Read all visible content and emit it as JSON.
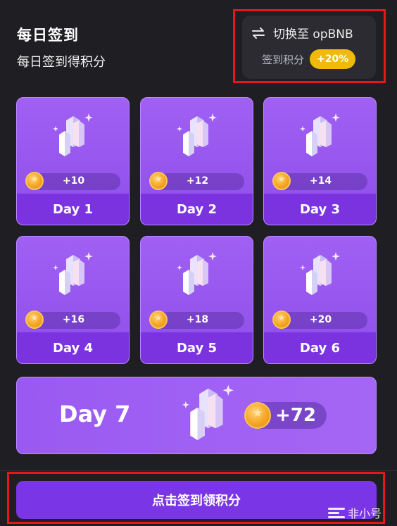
{
  "header": {
    "title": "每日签到",
    "subtitle": "每日签到得积分"
  },
  "switch": {
    "icon": "swap-arrows-icon",
    "label": "切换至 opBNB",
    "bonus_label": "签到积分",
    "bonus_value": "+20%",
    "bonus_color": "#f0b90b"
  },
  "days": [
    {
      "label": "Day 1",
      "points": "+10"
    },
    {
      "label": "Day 2",
      "points": "+12"
    },
    {
      "label": "Day 3",
      "points": "+14"
    },
    {
      "label": "Day 4",
      "points": "+16"
    },
    {
      "label": "Day 5",
      "points": "+18"
    },
    {
      "label": "Day 6",
      "points": "+20"
    }
  ],
  "day7": {
    "label": "Day 7",
    "points": "+72"
  },
  "action": {
    "claim_label": "点击签到领积分"
  },
  "watermark": {
    "text": "非小号"
  },
  "colors": {
    "background": "#1f1f23",
    "card": "#a160f3",
    "card_footer": "#7b33e0",
    "button": "#7a35e6",
    "highlight": "#e8151b"
  }
}
